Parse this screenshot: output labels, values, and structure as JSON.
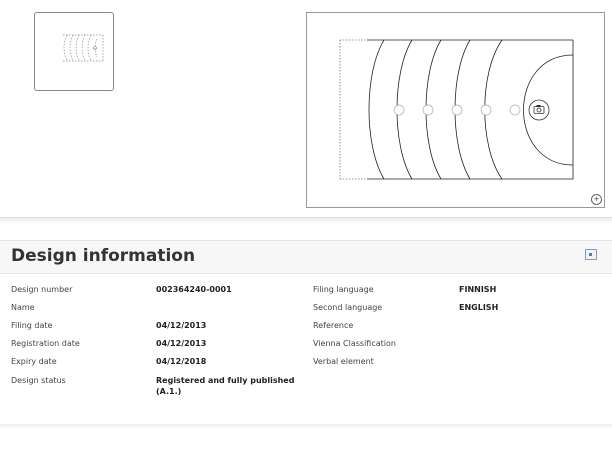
{
  "section": {
    "title": "Design information"
  },
  "left": [
    {
      "label": "Design number",
      "value": "002364240-0001"
    },
    {
      "label": "Name",
      "value": ""
    },
    {
      "label": "Filing date",
      "value": "04/12/2013"
    },
    {
      "label": "Registration date",
      "value": "04/12/2013"
    },
    {
      "label": "Expiry date",
      "value": "04/12/2018"
    },
    {
      "label": "Design status",
      "value": "Registered and fully published (A.1.)"
    }
  ],
  "right": [
    {
      "label": "Filing language",
      "value": "FINNISH"
    },
    {
      "label": "Second language",
      "value": "ENGLISH"
    },
    {
      "label": "Reference",
      "value": ""
    },
    {
      "label": "Vienna Classification",
      "value": ""
    },
    {
      "label": "Verbal element",
      "value": ""
    }
  ],
  "icons": {
    "zoom": "zoom-in-icon",
    "collapse": "collapse-icon",
    "camera": "camera-icon"
  }
}
